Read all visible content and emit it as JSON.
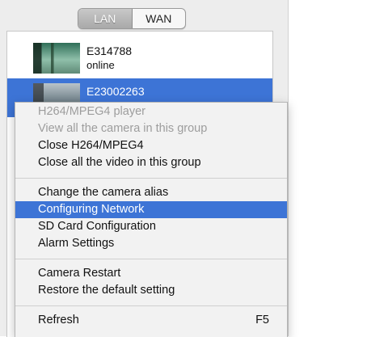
{
  "tabs": [
    {
      "label": "LAN",
      "active": true
    },
    {
      "label": "WAN",
      "active": false
    }
  ],
  "cameras": [
    {
      "name": "E314788",
      "status": "online",
      "selected": false
    },
    {
      "name": "E23002263",
      "status": "",
      "selected": true
    }
  ],
  "context_menu": {
    "groups": [
      [
        {
          "label": "H264/MPEG4 player",
          "enabled": false
        },
        {
          "label": "View all the camera in this group",
          "enabled": false
        },
        {
          "label": "Close H264/MPEG4",
          "enabled": true
        },
        {
          "label": "Close all the video in this group",
          "enabled": true
        }
      ],
      [
        {
          "label": "Change the camera alias",
          "enabled": true
        },
        {
          "label": "Configuring Network",
          "enabled": true,
          "highlighted": true
        },
        {
          "label": "SD Card Configuration",
          "enabled": true
        },
        {
          "label": "Alarm Settings",
          "enabled": true
        }
      ],
      [
        {
          "label": "Camera Restart",
          "enabled": true
        },
        {
          "label": "Restore the default setting",
          "enabled": true
        }
      ],
      [
        {
          "label": "Refresh",
          "shortcut": "F5",
          "enabled": true
        }
      ]
    ]
  },
  "colors": {
    "highlight": "#3d74d6",
    "disabled_text": "#9d9d9d"
  }
}
